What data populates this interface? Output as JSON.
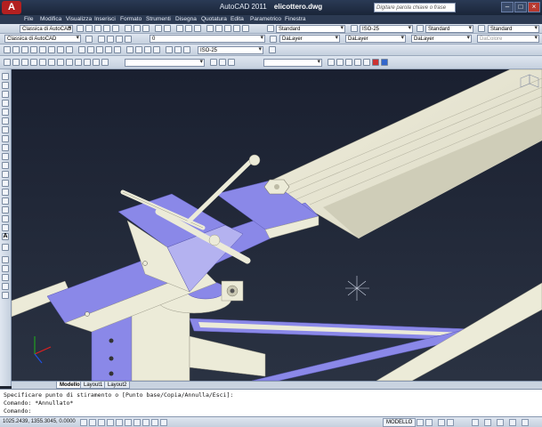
{
  "window": {
    "app_title": "AutoCAD 2011",
    "file_name": "elicottero.dwg",
    "app_button_letter": "A",
    "search_placeholder": "Digitare parola chiave o frase",
    "min_glyph": "–",
    "max_glyph": "□",
    "close_glyph": "×"
  },
  "menubar": {
    "items": [
      "File",
      "Modifica",
      "Visualizza",
      "Inserisci",
      "Formato",
      "Strumenti",
      "Disegna",
      "Quotatura",
      "Edita",
      "Parametrico",
      "Finestra"
    ]
  },
  "toolbars": {
    "workspace": "Classica di AutoCAD",
    "text_style": "Standard",
    "dim_style": "ISO-25",
    "table_style": "Standard",
    "multileader_style": "Standard",
    "layer_name": "0",
    "color": "DaLayer",
    "linetype": "DaLayer",
    "lineweight": "DaLayer",
    "plotstyle": "DaColore",
    "workspace2": "Classica di AutoCAD",
    "dim_style2": "ISO-25"
  },
  "left_toolbar": {
    "letter": "A"
  },
  "tabs": {
    "items": [
      "Modello",
      "Layout1",
      "Layout2"
    ]
  },
  "command_line": {
    "line1": "Specificare punto di stiramento o [Punto base/Copia/Annulla/Esci]:",
    "line2": "Comando: *Annullato*",
    "line3": "Comando:"
  },
  "status": {
    "coordinates": "1025.2439, 1355.3045, 0.0000",
    "mode": "MODELLO"
  },
  "colors": {
    "viewport_bg": "#222a36",
    "part_blue": "#8a88e8",
    "part_white": "#ecebd8"
  }
}
